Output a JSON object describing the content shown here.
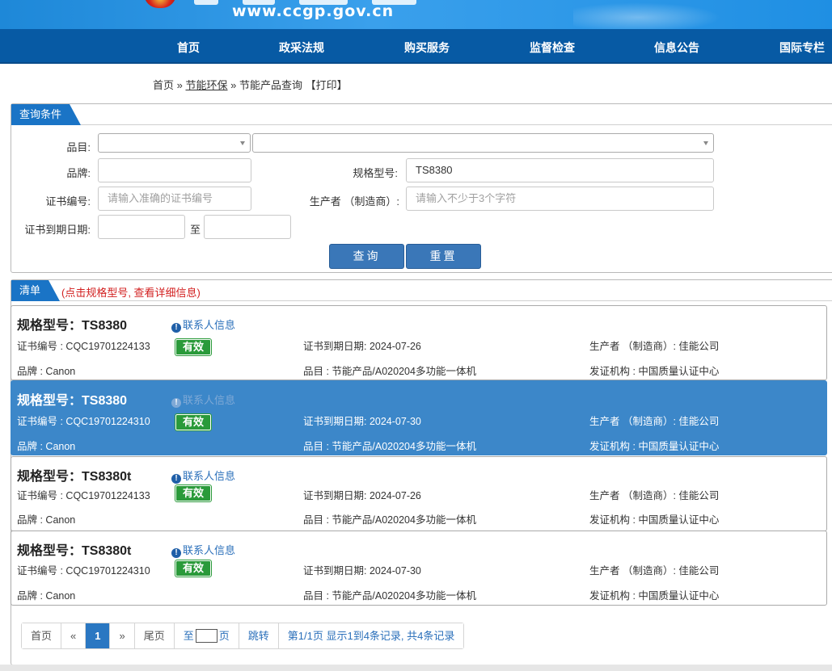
{
  "banner": {
    "url": "www.ccgp.gov.cn"
  },
  "nav": [
    "首页",
    "政采法规",
    "购买服务",
    "监督检查",
    "信息公告",
    "国际专栏"
  ],
  "breadcrumb": {
    "home": "首页",
    "sep1": "»",
    "section": "节能环保",
    "sep2": "»",
    "current": "节能产品查询",
    "print": "【打印】"
  },
  "query": {
    "tab": "查询条件",
    "category_label": "品目:",
    "brand_label": "品牌:",
    "model_label": "规格型号:",
    "model_value": "TS8380",
    "cert_label": "证书编号:",
    "cert_placeholder": "请输入准确的证书编号",
    "maker_label": "生产者 （制造商）:",
    "maker_placeholder": "请输入不少于3个字符",
    "expiry_label": "证书到期日期:",
    "to_label": "至",
    "search_button": "查询",
    "reset_button": "重置"
  },
  "list": {
    "tab": "清单",
    "hint": "(点击规格型号, 查看详细信息)",
    "contact_label": "联系人信息",
    "items": [
      {
        "title": "规格型号：TS8380",
        "cert": "证书编号 : CQC19701224133",
        "status": "有效",
        "expiry": "证书到期日期: 2024-07-26",
        "maker": "生产者 （制造商）: 佳能公司",
        "brand": "品牌 : Canon",
        "category": "品目 : 节能产品/A020204多功能一体机",
        "issuer": "发证机构 : 中国质量认证中心"
      },
      {
        "title": "规格型号：TS8380",
        "cert": "证书编号 : CQC19701224310",
        "status": "有效",
        "expiry": "证书到期日期: 2024-07-30",
        "maker": "生产者 （制造商）: 佳能公司",
        "brand": "品牌 : Canon",
        "category": "品目 : 节能产品/A020204多功能一体机",
        "issuer": "发证机构 : 中国质量认证中心"
      },
      {
        "title": "规格型号：TS8380t",
        "cert": "证书编号 : CQC19701224133",
        "status": "有效",
        "expiry": "证书到期日期: 2024-07-26",
        "maker": "生产者 （制造商）: 佳能公司",
        "brand": "品牌 : Canon",
        "category": "品目 : 节能产品/A020204多功能一体机",
        "issuer": "发证机构 : 中国质量认证中心"
      },
      {
        "title": "规格型号：TS8380t",
        "cert": "证书编号 : CQC19701224310",
        "status": "有效",
        "expiry": "证书到期日期: 2024-07-30",
        "maker": "生产者 （制造商）: 佳能公司",
        "brand": "品牌 : Canon",
        "category": "品目 : 节能产品/A020204多功能一体机",
        "issuer": "发证机构 : 中国质量认证中心"
      }
    ]
  },
  "pager": {
    "first": "首页",
    "prev": "«",
    "current": "1",
    "next": "»",
    "last": "尾页",
    "goto_prefix": "至",
    "goto_suffix": "页",
    "jump": "跳转",
    "summary": "第1/1页  显示1到4条记录, 共4条记录"
  },
  "colors": {
    "nav": "#075aa4",
    "accent": "#1a74c6",
    "active_row": "#3c87c9",
    "valid_badge": "#2a9a3a",
    "hint": "#d21f1f"
  }
}
